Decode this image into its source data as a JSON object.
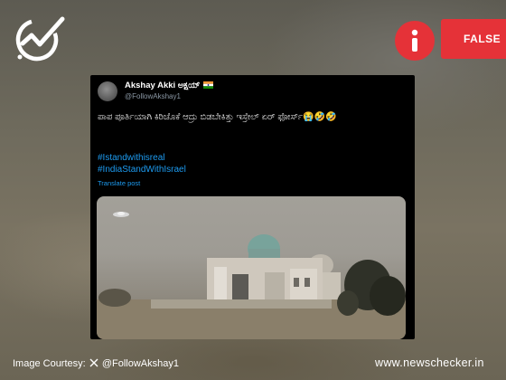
{
  "badge": {
    "verdict": "FALSE",
    "warning_icon": "info-exclamation-icon",
    "color": "#e53238"
  },
  "tweet": {
    "author_name": "Akshay Akki ಅಕ್ಷಯ್",
    "author_flag_icon": "india-flag-icon",
    "handle": "@FollowAkshay1",
    "text": "ಪಾಪ ಪೂರ್ತಿಯಾಗಿ ಕಿರಿಚೊಕೆ ಆದ್ರು ಬಿಡಬೇಕಿತ್ತು ಇಸ್ರೇಲ್ ಏರ್ ಫೋರ್ಸ್😭🤣🤣",
    "hashtags": [
      "#Istandwithisreal",
      "#IndiaStandWithIsrael"
    ],
    "translate_label": "Translate post",
    "link_color": "#1d9bf0"
  },
  "footer": {
    "courtesy_prefix": "Image Courtesy:",
    "courtesy_icon": "x-logo-icon",
    "courtesy_handle": "@FollowAkshay1",
    "site": "www.newschecker.in"
  }
}
